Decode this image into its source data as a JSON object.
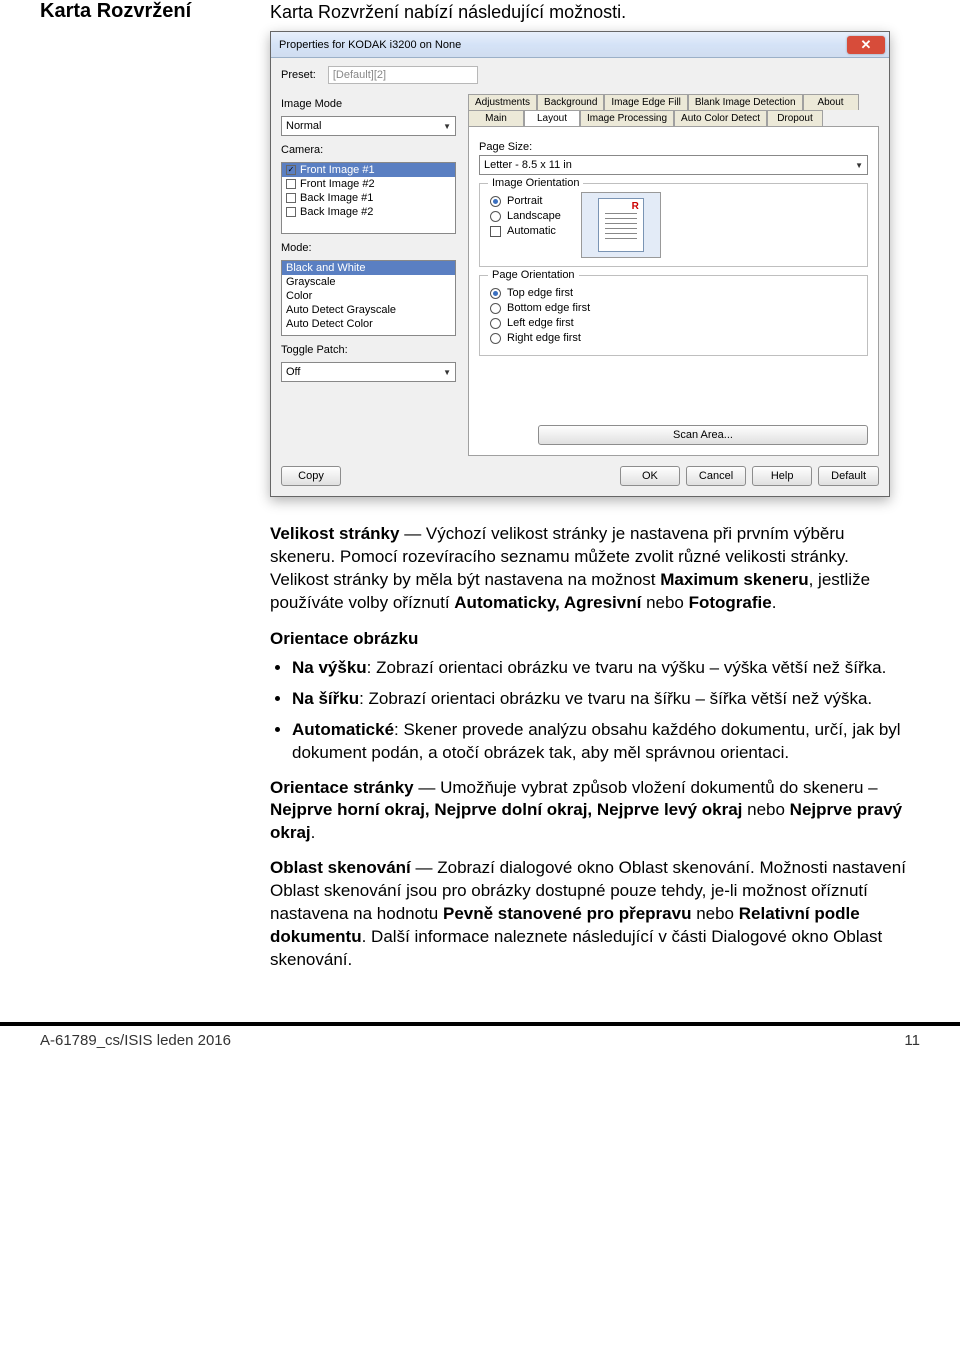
{
  "header": {
    "section_title": "Karta Rozvržení",
    "intro": "Karta Rozvržení nabízí následující možnosti."
  },
  "dialog": {
    "title": "Properties for KODAK i3200 on None",
    "close_glyph": "✕",
    "preset_label": "Preset:",
    "preset_value": "[Default][2]",
    "image_mode_label": "Image Mode",
    "image_mode_value": "Normal",
    "camera_label": "Camera:",
    "camera_items": [
      {
        "label": "Front Image #1",
        "checked": true,
        "selected": true
      },
      {
        "label": "Front Image #2",
        "checked": false,
        "selected": false
      },
      {
        "label": "Back Image #1",
        "checked": false,
        "selected": false
      },
      {
        "label": "Back Image #2",
        "checked": false,
        "selected": false
      }
    ],
    "mode_label": "Mode:",
    "mode_items": [
      {
        "label": "Black and White",
        "selected": true
      },
      {
        "label": "Grayscale",
        "selected": false
      },
      {
        "label": "Color",
        "selected": false
      },
      {
        "label": "Auto Detect Grayscale",
        "selected": false
      },
      {
        "label": "Auto Detect Color",
        "selected": false
      }
    ],
    "toggle_patch_label": "Toggle Patch:",
    "toggle_patch_value": "Off",
    "tabs_row1": [
      "Adjustments",
      "Background",
      "Image Edge Fill",
      "Blank Image Detection",
      "About"
    ],
    "tabs_row2": [
      "Main",
      "Layout",
      "Image Processing",
      "Auto Color Detect",
      "Dropout"
    ],
    "active_tab": "Layout",
    "page_size_label": "Page Size:",
    "page_size_value": "Letter - 8.5 x 11 in",
    "image_orientation_label": "Image Orientation",
    "img_orient_portrait": "Portrait",
    "img_orient_landscape": "Landscape",
    "img_orient_auto": "Automatic",
    "page_orientation_label": "Page Orientation",
    "po_top": "Top edge first",
    "po_bottom": "Bottom edge first",
    "po_left": "Left edge first",
    "po_right": "Right edge first",
    "scan_area_btn": "Scan Area...",
    "btn_copy": "Copy",
    "btn_ok": "OK",
    "btn_cancel": "Cancel",
    "btn_help": "Help",
    "btn_default": "Default"
  },
  "body": {
    "p1_a": "Velikost stránky",
    "p1_b": " — Výchozí velikost stránky je nastavena při prvním výběru skeneru. Pomocí rozevíracího seznamu můžete zvolit různé velikosti stránky. Velikost stránky by měla být nastavena na možnost ",
    "p1_c": "Maximum skeneru",
    "p1_d": ", jestliže používáte volby oříznutí ",
    "p1_e": "Automaticky, Agresivní",
    "p1_f": " nebo ",
    "p1_g": "Fotografie",
    "p1_h": ".",
    "sub1": "Orientace obrázku",
    "li1_a": "Na výšku",
    "li1_b": ": Zobrazí orientaci obrázku ve tvaru na výšku – výška větší než šířka.",
    "li2_a": "Na šířku",
    "li2_b": ": Zobrazí orientaci obrázku ve tvaru na šířku – šířka větší než výška.",
    "li3_a": "Automatické",
    "li3_b": ": Skener provede analýzu obsahu každého dokumentu, určí, jak byl dokument podán, a otočí obrázek tak, aby měl správnou orientaci.",
    "p2_a": "Orientace stránky",
    "p2_b": " — Umožňuje vybrat způsob vložení dokumentů do skeneru – ",
    "p2_c": "Nejprve horní okraj, Nejprve dolní okraj, Nejprve levý okraj",
    "p2_d": " nebo ",
    "p2_e": "Nejprve pravý okraj",
    "p2_f": ".",
    "p3_a": "Oblast skenování",
    "p3_b": " — Zobrazí dialogové okno Oblast skenování. Možnosti nastavení Oblast skenování jsou pro obrázky dostupné pouze tehdy, je-li možnost oříznutí nastavena na hodnotu ",
    "p3_c": "Pevně stanovené pro přepravu",
    "p3_d": " nebo ",
    "p3_e": "Relativní podle dokumentu",
    "p3_f": ". Další informace naleznete následující v části Dialogové okno Oblast skenování."
  },
  "footer": {
    "left": "A-61789_cs/ISIS  leden  2016",
    "right": "11"
  }
}
